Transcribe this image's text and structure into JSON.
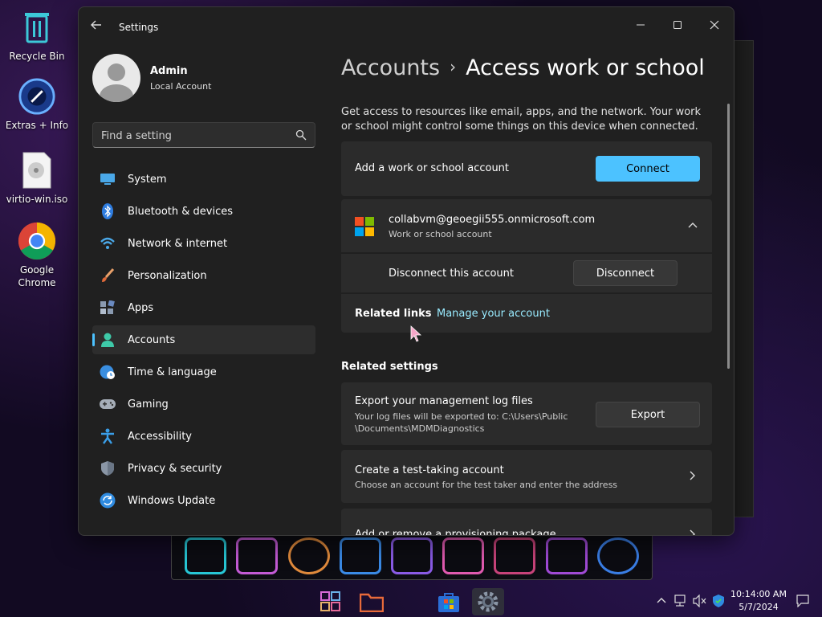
{
  "desktop": {
    "icons": [
      {
        "label": "Recycle Bin"
      },
      {
        "label": "Extras + Info"
      },
      {
        "label": "virtio-win.iso"
      },
      {
        "label": "Google Chrome"
      }
    ]
  },
  "window": {
    "title": "Settings",
    "back_icon": "back-arrow-icon",
    "controls": [
      "minimize",
      "maximize",
      "close"
    ]
  },
  "profile": {
    "name": "Admin",
    "account_type": "Local Account"
  },
  "search": {
    "placeholder": "Find a setting",
    "value": ""
  },
  "sidebar": {
    "items": [
      {
        "label": "System",
        "icon": "monitor-icon",
        "active": false
      },
      {
        "label": "Bluetooth & devices",
        "icon": "bluetooth-icon",
        "active": false
      },
      {
        "label": "Network & internet",
        "icon": "wifi-icon",
        "active": false
      },
      {
        "label": "Personalization",
        "icon": "brush-icon",
        "active": false
      },
      {
        "label": "Apps",
        "icon": "apps-icon",
        "active": false
      },
      {
        "label": "Accounts",
        "icon": "person-icon",
        "active": true
      },
      {
        "label": "Time & language",
        "icon": "globe-clock-icon",
        "active": false
      },
      {
        "label": "Gaming",
        "icon": "gamepad-icon",
        "active": false
      },
      {
        "label": "Accessibility",
        "icon": "accessibility-icon",
        "active": false
      },
      {
        "label": "Privacy & security",
        "icon": "shield-icon",
        "active": false
      },
      {
        "label": "Windows Update",
        "icon": "update-icon",
        "active": false
      }
    ]
  },
  "main": {
    "breadcrumb_parent": "Accounts",
    "breadcrumb_separator": "›",
    "page_title": "Access work or school",
    "description": "Get access to resources like email, apps, and the network. Your work or school might control some things on this device when connected.",
    "add_account": {
      "label": "Add a work or school account",
      "button": "Connect"
    },
    "account": {
      "email": "collabvm@geoegii555.onmicrosoft.com",
      "type": "Work or school account",
      "disconnect_label": "Disconnect this account",
      "disconnect_button": "Disconnect",
      "related_links_label": "Related links",
      "manage_link": "Manage your account"
    },
    "related_settings_heading": "Related settings",
    "export": {
      "title": "Export your management log files",
      "subtitle": "Your log files will be exported to: C:\\Users\\Public\\Documents\\MDMDiagnostics",
      "button": "Export"
    },
    "test_account": {
      "title": "Create a test-taking account",
      "subtitle": "Choose an account for the test taker and enter the address"
    },
    "provisioning": {
      "title": "Add or remove a provisioning package"
    }
  },
  "taskbar": {
    "clock_time": "10:14:00 AM",
    "clock_date": "5/7/2024"
  },
  "colors": {
    "accent": "#4cc2ff",
    "window_bg": "#202020",
    "card_bg": "#2b2b2b",
    "link": "#99ebff"
  }
}
